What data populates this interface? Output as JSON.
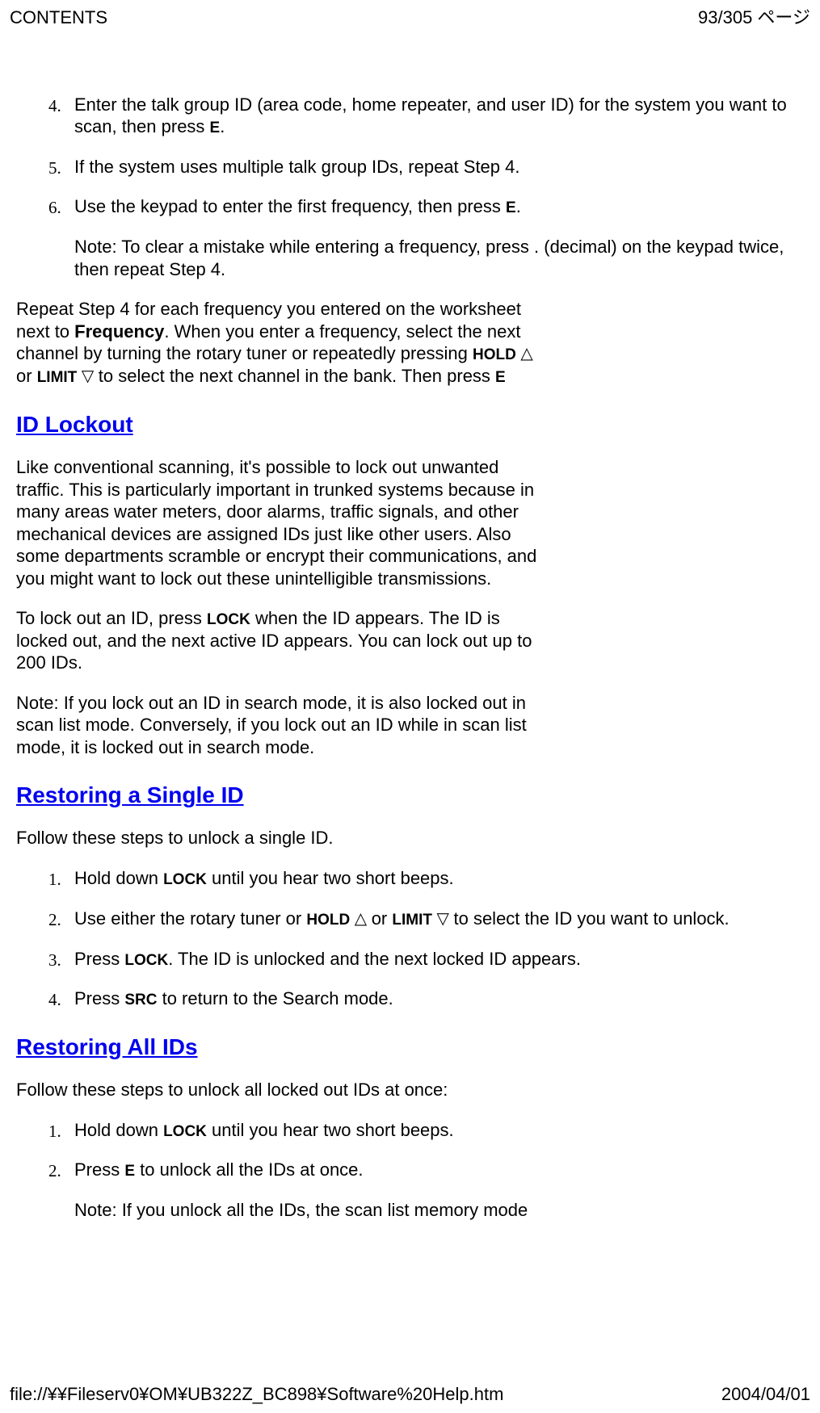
{
  "header": {
    "title": "CONTENTS",
    "page_indicator": "93/305 ページ"
  },
  "topList": {
    "items": [
      {
        "num": "4.",
        "text_before": "Enter the talk group ID (area code, home repeater, and user ID) for the system you want to scan, then press ",
        "key1": "E",
        "text_after": "."
      },
      {
        "num": "5.",
        "text_before": "If the system uses multiple talk group IDs, repeat Step 4."
      },
      {
        "num": "6.",
        "text_before": "Use the keypad to enter the first frequency, then press ",
        "key1": "E",
        "text_after": ".",
        "note": "Note: To clear a mistake while entering a frequency, press . (decimal) on the keypad twice, then repeat Step 4."
      }
    ]
  },
  "repeatPara": {
    "p1": "Repeat Step 4 for each frequency you entered on the worksheet next to ",
    "b1": "Frequency",
    "p2": ". When you enter a frequency, select the next channel by turning the rotary tuner or repeatedly pressing ",
    "b2": "HOLD",
    "tri_up": " △ ",
    "p3": "or ",
    "b3": "LIMIT",
    "tri_down": " ▽ ",
    "p4": "to select the next channel in the bank. Then press ",
    "b4": "E"
  },
  "sections": {
    "idLockout": {
      "heading": "ID Lockout",
      "p1": "Like conventional scanning, it's possible to lock out unwanted traffic. This is particularly important in trunked systems because in many areas water meters, door alarms, traffic signals, and other mechanical devices are assigned IDs just like other users. Also some departments scramble or encrypt their communications, and you might want to lock out these unintelligible transmissions.",
      "p2a": "To lock out an ID, press ",
      "p2key": "LOCK",
      "p2b": " when the ID appears. The ID is locked out, and the next active ID appears. You can lock out up to 200 IDs.",
      "p3": "Note: If you lock out an ID in search mode, it is also locked out in scan list mode. Conversely, if you lock out an ID while in scan list mode, it is locked out in search mode."
    },
    "restoringSingle": {
      "heading": "Restoring a Single ID",
      "intro": "Follow these steps to unlock a single ID.",
      "items": [
        {
          "num": "1.",
          "a": "Hold down ",
          "k1": "LOCK",
          "b": " until you hear two short beeps."
        },
        {
          "num": "2.",
          "a": "Use either the rotary tuner or ",
          "k1": "HOLD",
          "up": " △ ",
          "mid": "or ",
          "k2": "LIMIT",
          "down": " ▽ ",
          "b": "to select the ID you want to unlock."
        },
        {
          "num": "3.",
          "a": "Press ",
          "k1": "LOCK",
          "b": ". The ID is unlocked and the next locked ID appears."
        },
        {
          "num": "4.",
          "a": "Press ",
          "k1": "SRC",
          "b": " to return to the Search mode."
        }
      ]
    },
    "restoringAll": {
      "heading": "Restoring All IDs",
      "intro": "Follow these steps to unlock all locked out IDs at once:",
      "items": [
        {
          "num": "1.",
          "a": "Hold down ",
          "k1": "LOCK",
          "b": " until you hear two short beeps."
        },
        {
          "num": "2.",
          "a": "Press ",
          "k1": "E",
          "b": " to unlock all the IDs at once.",
          "note": "Note: If you unlock all the IDs, the scan list memory mode"
        }
      ]
    }
  },
  "footer": {
    "path": "file://¥¥Fileserv0¥OM¥UB322Z_BC898¥Software%20Help.htm",
    "date": "2004/04/01"
  }
}
